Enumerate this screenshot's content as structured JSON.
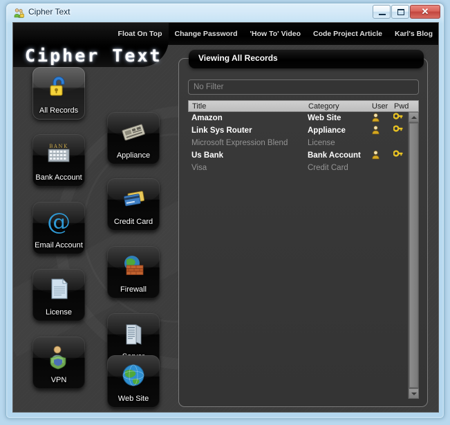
{
  "window": {
    "title": "Cipher Text",
    "title_icon": "people-lock-icon",
    "buttons": {
      "minimize": "minimize-button",
      "maximize": "maximize-button",
      "close": "✕"
    }
  },
  "branding": {
    "logo_text": "Cipher Text"
  },
  "nav": {
    "links": [
      {
        "label": "Float On Top"
      },
      {
        "label": "Change Password"
      },
      {
        "label": "'How To' Video"
      },
      {
        "label": "Code Project Article"
      },
      {
        "label": "Karl's Blog"
      }
    ]
  },
  "sidebar": {
    "items": [
      {
        "label": "All Records",
        "icon": "unlocked-padlock-icon",
        "selected": true,
        "col": 0
      },
      {
        "label": "Appliance",
        "icon": "circuit-board-icon",
        "selected": false,
        "col": 1
      },
      {
        "label": "Bank Account",
        "icon": "bank-building-icon",
        "selected": false,
        "col": 0
      },
      {
        "label": "Credit Card",
        "icon": "credit-card-icon",
        "selected": false,
        "col": 1
      },
      {
        "label": "Email Account",
        "icon": "at-sign-icon",
        "selected": false,
        "col": 0
      },
      {
        "label": "Firewall",
        "icon": "firewall-brick-icon",
        "selected": false,
        "col": 1
      },
      {
        "label": "License",
        "icon": "document-icon",
        "selected": false,
        "col": 0
      },
      {
        "label": "Server",
        "icon": "server-tower-icon",
        "selected": false,
        "col": 1
      },
      {
        "label": "VPN",
        "icon": "vpn-user-shield-icon",
        "selected": false,
        "col": 0
      },
      {
        "label": "Web Site",
        "icon": "globe-icon",
        "selected": false,
        "col": 1
      }
    ]
  },
  "panel": {
    "header_title": "Viewing All Records",
    "filter": {
      "value": "",
      "placeholder": "No Filter"
    },
    "table": {
      "columns": [
        {
          "key": "title",
          "label": "Title"
        },
        {
          "key": "category",
          "label": "Category"
        },
        {
          "key": "user",
          "label": "User"
        },
        {
          "key": "pwd",
          "label": "Pwd"
        }
      ],
      "rows": [
        {
          "title": "Amazon",
          "category": "Web Site",
          "user": true,
          "pwd": true
        },
        {
          "title": "Link Sys Router",
          "category": "Appliance",
          "user": true,
          "pwd": true
        },
        {
          "title": "Microsoft Expression Blend",
          "category": "License",
          "user": false,
          "pwd": false
        },
        {
          "title": "Us Bank",
          "category": "Bank Account",
          "user": true,
          "pwd": true
        },
        {
          "title": "Visa",
          "category": "Credit Card",
          "user": false,
          "pwd": false
        }
      ]
    },
    "scrollbar": {
      "up_arrow": "scroll-up-icon",
      "down_arrow": "scroll-down-icon"
    }
  },
  "colors": {
    "app_background": "#3d3d3d",
    "panel_background": "#373737",
    "header_black": "#000000",
    "accent_gold": "#d9a520",
    "frame_blue": "#b8d8ee",
    "text_white": "#ffffff",
    "text_dim": "#949494"
  }
}
